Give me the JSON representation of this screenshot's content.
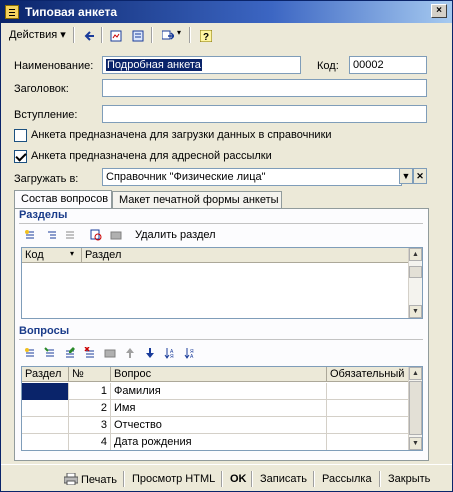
{
  "window": {
    "title": "Типовая анкета",
    "close_label": "×"
  },
  "toolbar": {
    "actions_label": "Действия ▾",
    "icons": [
      "arrow-left-icon",
      "form-icon",
      "refresh-icon",
      "navigate-icon",
      "help-icon"
    ]
  },
  "form": {
    "name_label": "Наименование:",
    "name_value": "Подробная анкета",
    "code_label": "Код:",
    "code_value": "00002",
    "heading_label": "Заголовок:",
    "heading_value": "",
    "intro_label": "Вступление:",
    "intro_value": "",
    "checkbox1_label": "Анкета предназначена для загрузки данных в справочники",
    "checkbox1_checked": false,
    "checkbox2_label": "Анкета предназначена для адресной рассылки",
    "checkbox2_checked": true,
    "load_label": "Загружать в:",
    "load_value": "Справочник \"Физические лица\""
  },
  "tabs": [
    {
      "label": "Состав вопросов",
      "active": true
    },
    {
      "label": "Макет печатной формы анкеты",
      "active": false
    }
  ],
  "sections": {
    "title": "Разделы",
    "delete_label": "Удалить раздел",
    "columns": [
      "Код",
      "Раздел"
    ]
  },
  "questions": {
    "title": "Вопросы",
    "columns": [
      "Раздел",
      "№",
      "Вопрос",
      "Обязательный"
    ],
    "rows": [
      {
        "section": "",
        "num": "1",
        "question": "Фамилия",
        "required": ""
      },
      {
        "section": "",
        "num": "2",
        "question": "Имя",
        "required": ""
      },
      {
        "section": "",
        "num": "3",
        "question": "Отчество",
        "required": ""
      },
      {
        "section": "",
        "num": "4",
        "question": "Дата рождения",
        "required": ""
      }
    ]
  },
  "bottom": {
    "print": "Печать",
    "preview_html": "Просмотр HTML",
    "ok": "OK",
    "save": "Записать",
    "mailing": "Рассылка",
    "close": "Закрыть"
  }
}
